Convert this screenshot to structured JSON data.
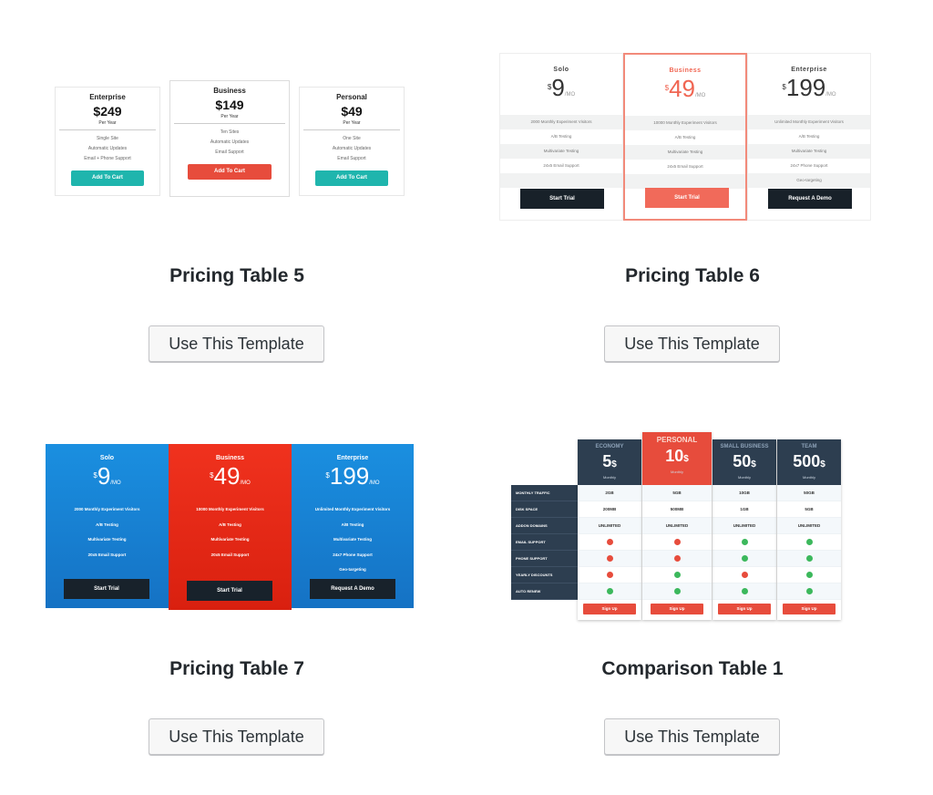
{
  "cards": [
    {
      "title": "Pricing Table 5",
      "button": "Use This Template"
    },
    {
      "title": "Pricing Table 6",
      "button": "Use This Template"
    },
    {
      "title": "Pricing Table 7",
      "button": "Use This Template"
    },
    {
      "title": "Comparison Table 1",
      "button": "Use This Template"
    }
  ],
  "pt5": {
    "cols": [
      {
        "name": "Enterprise",
        "price": "$249",
        "per": "Per Year",
        "features": [
          "Single Site",
          "Automatic Updates",
          "Email + Phone Support"
        ],
        "button": "Add To Cart"
      },
      {
        "name": "Business",
        "price": "$149",
        "per": "Per Year",
        "features": [
          "Ten Sites",
          "Automatic Updates",
          "Email Support"
        ],
        "button": "Add To Cart"
      },
      {
        "name": "Personal",
        "price": "$49",
        "per": "Per Year",
        "features": [
          "One Site",
          "Automatic Updates",
          "Email Support"
        ],
        "button": "Add To Cart"
      }
    ]
  },
  "pt6": {
    "cols": [
      {
        "name": "Solo",
        "currency": "$",
        "amount": "9",
        "unit": "/MO",
        "features": [
          "2000 Monthly Experiment Visitors",
          "A/B Testing",
          "Multivariate Testing",
          "24x5 Email Support",
          ""
        ],
        "button": "Start Trial"
      },
      {
        "name": "Business",
        "currency": "$",
        "amount": "49",
        "unit": "/MO",
        "features": [
          "10000 Monthly Experiment Visitors",
          "A/B Testing",
          "Multivariate Testing",
          "24x5 Email Support",
          ""
        ],
        "button": "Start Trial"
      },
      {
        "name": "Enterprise",
        "currency": "$",
        "amount": "199",
        "unit": "/MO",
        "features": [
          "Unlimited Monthly Experiment Visitors",
          "A/B Testing",
          "Multivariate Testing",
          "24x7 Phone Support",
          "Geo-targeting"
        ],
        "button": "Request A Demo"
      }
    ]
  },
  "pt7": {
    "cols": [
      {
        "name": "Solo",
        "currency": "$",
        "amount": "9",
        "unit": "/MO",
        "features": [
          "2000 Monthly Experiment Visitors",
          "A/B Testing",
          "Multivariate Testing",
          "20x5 Email Support",
          ""
        ],
        "button": "Start Trial"
      },
      {
        "name": "Business",
        "currency": "$",
        "amount": "49",
        "unit": "/MO",
        "features": [
          "10000 Monthly Experiment Visitors",
          "A/B Testing",
          "Multivariate Testing",
          "20x5 Email Support",
          ""
        ],
        "button": "Start Trial"
      },
      {
        "name": "Enterprise",
        "currency": "$",
        "amount": "199",
        "unit": "/MO",
        "features": [
          "Unlimited Monthly Experiment Visitors",
          "A/B Testing",
          "Multivariate Testing",
          "24x7 Phone Support",
          "Geo-targeting"
        ],
        "button": "Request A Demo"
      }
    ]
  },
  "ct1": {
    "labels": [
      "MONTHLY TRAFFIC",
      "DISK SPACE",
      "ADDON DOMAINS",
      "EMAIL SUPPORT",
      "PHONE SUPPORT",
      "YEARLY DISCOUNTS",
      "AUTO RENEW"
    ],
    "plans": [
      {
        "name": "ECONOMY",
        "price": "5",
        "currency": "$",
        "period": "Monthly",
        "values": [
          "2GB",
          "200MB",
          "UNLIMITED"
        ],
        "marks": [
          "no",
          "no",
          "no",
          "yes"
        ],
        "button": "Sign Up"
      },
      {
        "name": "PERSONAL",
        "price": "10",
        "currency": "$",
        "period": "Monthly",
        "values": [
          "5GB",
          "500MB",
          "UNLIMITED"
        ],
        "marks": [
          "no",
          "no",
          "yes",
          "yes"
        ],
        "button": "Sign Up"
      },
      {
        "name": "SMALL BUSINESS",
        "price": "50",
        "currency": "$",
        "period": "Monthly",
        "values": [
          "10GB",
          "1GB",
          "UNLIMITED"
        ],
        "marks": [
          "yes",
          "yes",
          "no",
          "yes"
        ],
        "button": "Sign Up"
      },
      {
        "name": "TEAM",
        "price": "500",
        "currency": "$",
        "period": "Monthly",
        "values": [
          "50GB",
          "5GB",
          "UNLIMITED"
        ],
        "marks": [
          "yes",
          "yes",
          "yes",
          "yes"
        ],
        "button": "Sign Up"
      }
    ]
  }
}
